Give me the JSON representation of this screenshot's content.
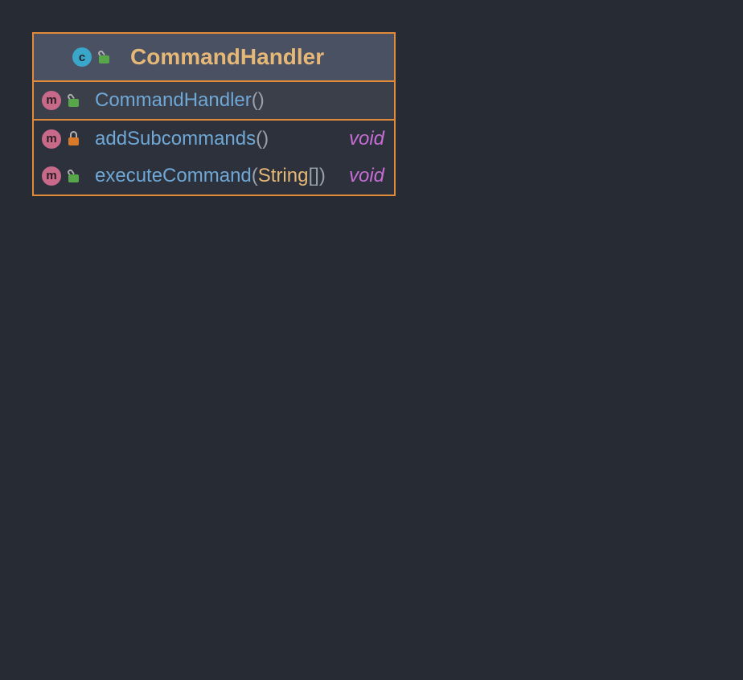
{
  "class": {
    "kind_letter": "c",
    "name": "CommandHandler",
    "visibility": "public",
    "vis_color": "green"
  },
  "constructor": {
    "kind_letter": "m",
    "name": "CommandHandler",
    "params_open": "(",
    "params_close": ")",
    "visibility": "public",
    "vis_color": "green"
  },
  "methods": [
    {
      "kind_letter": "m",
      "name": "addSubcommands",
      "params_open": "(",
      "params_close": ")",
      "param_type": "",
      "param_suffix": "",
      "return_type": "void",
      "visibility": "private",
      "vis_color": "orange"
    },
    {
      "kind_letter": "m",
      "name": "executeCommand",
      "params_open": "(",
      "params_close": ")",
      "param_type": "String",
      "param_suffix": "[]",
      "return_type": "void",
      "visibility": "public",
      "vis_color": "green"
    }
  ],
  "colors": {
    "background": "#262b34",
    "card_border": "#e08a3a",
    "header_bg": "#4a5162",
    "class_name": "#e6b877",
    "member_name": "#6fa8d6",
    "param_type": "#e6b877",
    "return_type": "#c76ed6",
    "public_icon": "#57a64a",
    "private_icon": "#d87a2a",
    "class_badge": "#3aa6c9",
    "method_badge": "#c76a8a"
  }
}
